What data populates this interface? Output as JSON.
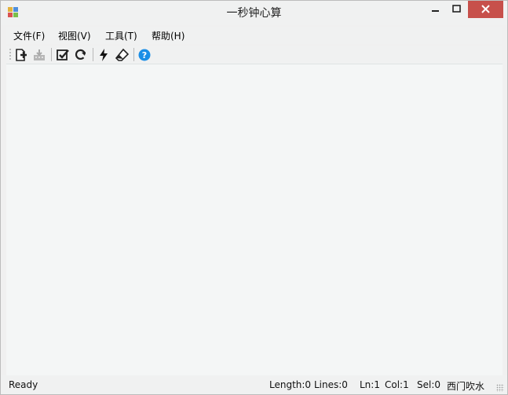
{
  "window": {
    "title": "一秒钟心算"
  },
  "menu": {
    "items": [
      {
        "label": "文件(F)"
      },
      {
        "label": "视图(V)"
      },
      {
        "label": "工具(T)"
      },
      {
        "label": "帮助(H)"
      }
    ]
  },
  "toolbar": {
    "buttons": [
      {
        "icon": "new-file-plus-icon"
      },
      {
        "icon": "save-disabled-icon"
      },
      {
        "icon": "checkbox-check-icon"
      },
      {
        "icon": "refresh-icon"
      },
      {
        "icon": "lightning-icon"
      },
      {
        "icon": "eraser-icon"
      },
      {
        "icon": "help-icon"
      }
    ]
  },
  "status": {
    "ready": "Ready",
    "length": "Length:0",
    "lines": "Lines:0",
    "ln": "Ln:1",
    "col": "Col:1",
    "sel": "Sel:0",
    "author": "西门吹水"
  },
  "colors": {
    "close_button": "#c7504b",
    "help_icon": "#1a8ee6",
    "editor_bg": "#f4f6f6"
  }
}
